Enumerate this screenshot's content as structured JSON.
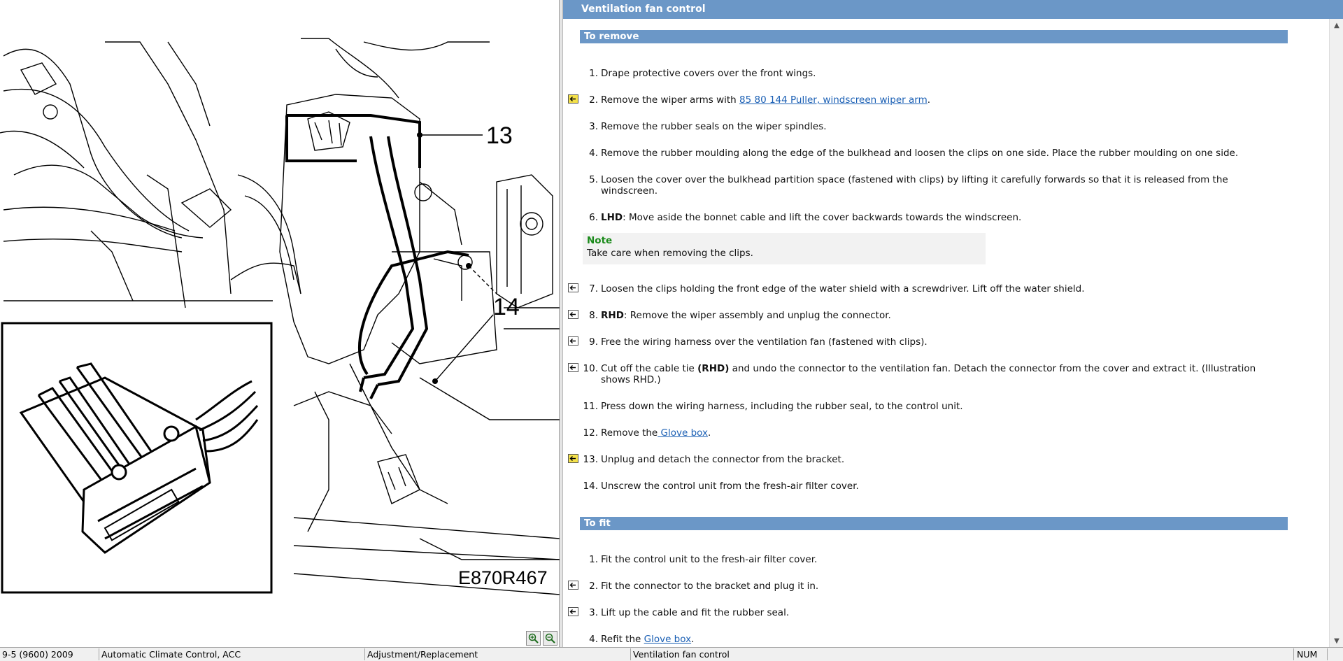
{
  "illustration": {
    "callouts": [
      "13",
      "14"
    ],
    "code": "E870R467"
  },
  "window": {
    "title": "Ventilation fan control"
  },
  "remove_section": {
    "header": "To remove",
    "steps": [
      {
        "num": "1.",
        "text": "Drape protective covers over the front wings."
      },
      {
        "num": "2.",
        "pre": "Remove the wiper arms with ",
        "link": "85 80 144 Puller, windscreen wiper arm",
        "post": "."
      },
      {
        "num": "3.",
        "text": "Remove the rubber seals on the wiper spindles."
      },
      {
        "num": "4.",
        "text": "Remove the rubber moulding along the edge of the bulkhead and loosen the clips on one side. Place the rubber moulding on one side."
      },
      {
        "num": "5.",
        "line1": "Loosen the cover over the bulkhead partition space (fastened with clips) by lifting it carefully forwards so that it is released from the",
        "line2": "windscreen."
      },
      {
        "num": "6.",
        "bold": "LHD",
        "text": ": Move aside the bonnet cable and lift the cover backwards towards the windscreen."
      },
      {
        "num": "7.",
        "text": "Loosen the clips holding the front edge of the water shield with a screwdriver. Lift off the water shield."
      },
      {
        "num": "8.",
        "bold": "RHD",
        "text": ": Remove the wiper assembly and unplug the connector."
      },
      {
        "num": "9.",
        "text": "Free the wiring harness over the ventilation fan (fastened with clips)."
      },
      {
        "num": "10.",
        "pre": "Cut off the cable tie ",
        "bold": "(RHD)",
        "post": " and undo the connector to the ventilation fan. Detach the connector from the cover and extract it. (Illustration",
        "line2": "shows RHD.)"
      },
      {
        "num": "11.",
        "text": "Press down the wiring harness, including the rubber seal, to the control unit."
      },
      {
        "num": "12.",
        "pre": "Remove the",
        "link": " Glove box",
        "post": "."
      },
      {
        "num": "13.",
        "text": "Unplug and detach the connector from the bracket."
      },
      {
        "num": "14.",
        "text": "Unscrew the control unit from the fresh-air filter cover."
      }
    ]
  },
  "note": {
    "title": "Note",
    "text": "Take care when removing the clips."
  },
  "fit_section": {
    "header": "To fit",
    "steps": [
      {
        "num": "1.",
        "text": "Fit the control unit to the fresh-air filter cover."
      },
      {
        "num": "2.",
        "text": "Fit the connector to the bracket and plug it in."
      },
      {
        "num": "3.",
        "text": "Lift up the cable and fit the rubber seal."
      },
      {
        "num": "4.",
        "pre": "Refit the ",
        "link": "Glove box",
        "post": "."
      }
    ]
  },
  "status_bar": {
    "model": "9-5 (9600) 2009",
    "system": "Automatic Climate Control, ACC",
    "operation": "Adjustment/Replacement",
    "topic": "Ventilation fan control",
    "num": "NUM"
  },
  "colors": {
    "header_blue": "#6b97c7",
    "link_blue": "#1a5fb4",
    "note_green": "#1a8a1a"
  }
}
